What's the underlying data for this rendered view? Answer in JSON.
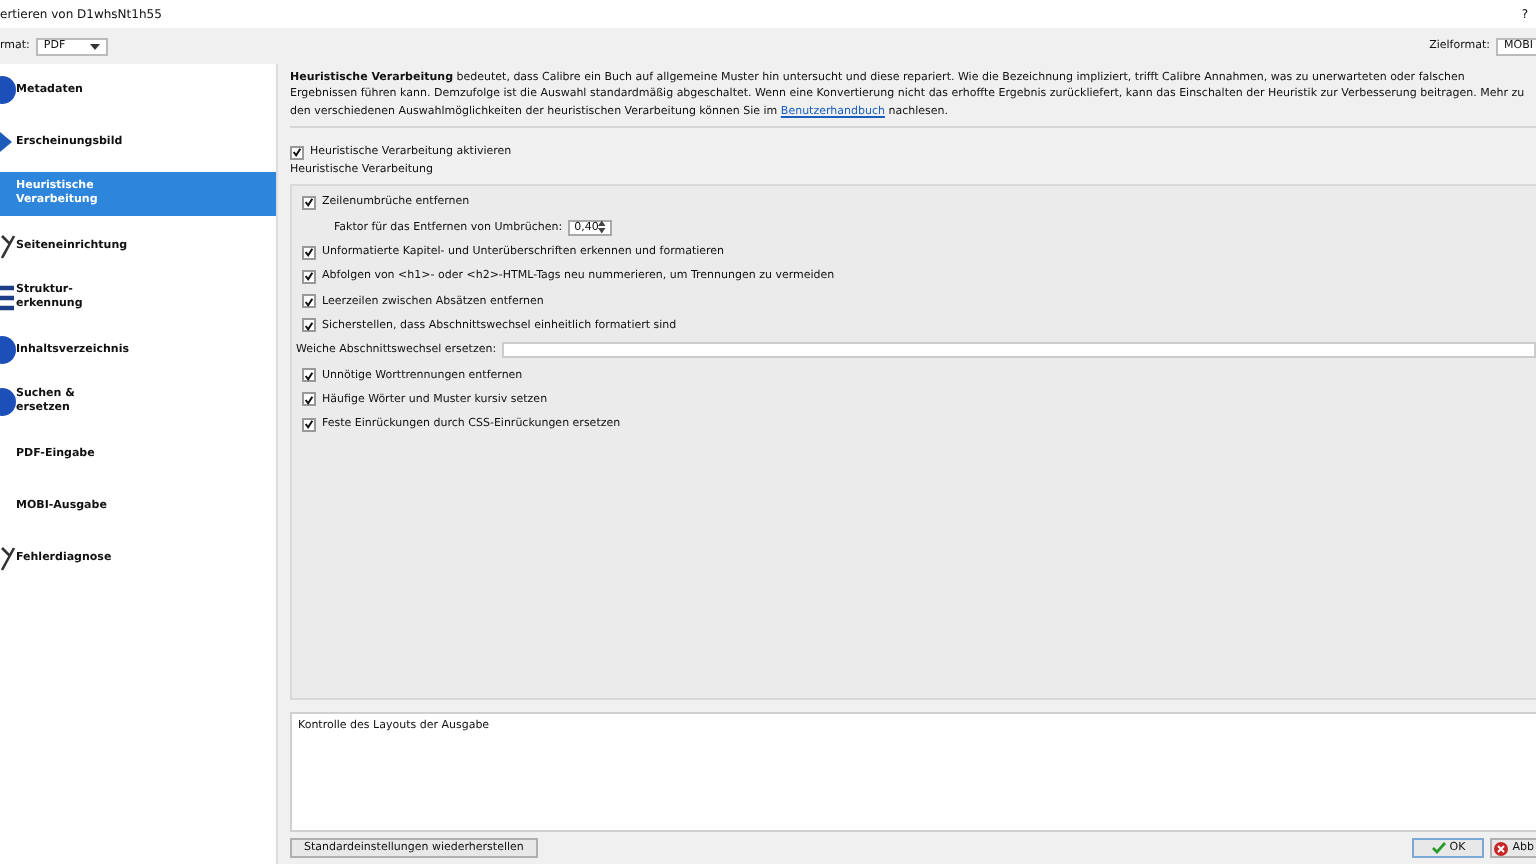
{
  "window": {
    "title": "ertieren von D1whsNt1h55",
    "help": "?"
  },
  "input_format": {
    "label": "rmat:",
    "value": "PDF"
  },
  "output_format": {
    "label": "Zielformat:",
    "value": "MOBI"
  },
  "sidebar": {
    "items": [
      {
        "label": "Metadaten",
        "selected": false
      },
      {
        "label": "Erscheinungsbild",
        "selected": false
      },
      {
        "label": "Heuristische Verarbeitung",
        "selected": true
      },
      {
        "label": "Seiteneinrichtung",
        "selected": false
      },
      {
        "label": "Struktur-erkennung",
        "selected": false
      },
      {
        "label": "Inhaltsverzeichnis",
        "selected": false
      },
      {
        "label": "Suchen & ersetzen",
        "selected": false
      },
      {
        "label": "PDF-Eingabe",
        "selected": false
      },
      {
        "label": "MOBI-Ausgabe",
        "selected": false
      },
      {
        "label": "Fehlerdiagnose",
        "selected": false
      }
    ]
  },
  "description": {
    "text": "**Heuristische Verarbeitung** bedeutet, dass Calibre ein Buch auf allgemeine Muster hin untersucht und diese repariert. Wie die Bezeichnung impliziert, trifft Calibre Annahmen, was zu unerwarteten oder falschen Ergebnissen führen kann. Demzufolge ist die Auswahl standardmäßig abgeschaltet. Wenn eine Konvertierung nicht das erhoffte Ergebnis zurückliefert, kann das Einschalten der Heuristik zur Verbesserung beitragen. Mehr zu den verschiedenen Auswahlmöglichkeiten der heuristischen Verarbeitung können Sie im ",
    "link": "Benutzerhandbuch",
    "end": " nachlesen."
  },
  "enable": {
    "label": "Heuristische Verarbeitung aktivieren",
    "checked": true
  },
  "group": {
    "title": "Heuristische Verarbeitung",
    "options": [
      {
        "kind": "checkbox",
        "label": "Zeilenumbrüche entfernen",
        "checked": true
      },
      {
        "kind": "spinner",
        "label": "Faktor für das Entfernen von Umbrüchen:",
        "value": "0,40"
      },
      {
        "kind": "checkbox",
        "label": "Unformatierte Kapitel- und Unterüberschriften erkennen und formatieren",
        "checked": true
      },
      {
        "kind": "checkbox",
        "label": "Abfolgen von <h1>- oder <h2>-HTML-Tags neu nummerieren, um Trennungen zu vermeiden",
        "checked": true
      },
      {
        "kind": "checkbox",
        "label": "Leerzeilen zwischen Absätzen entfernen",
        "checked": true
      },
      {
        "kind": "checkbox",
        "label": "Sicherstellen, dass Abschnittswechsel einheitlich formatiert sind",
        "checked": true
      },
      {
        "kind": "textfield",
        "label": "Weiche Abschnittswechsel ersetzen:"
      },
      {
        "kind": "checkbox",
        "label": "Unnötige Worttrennungen entfernen",
        "checked": true
      },
      {
        "kind": "checkbox",
        "label": "Häufige Wörter und Muster kursiv setzen",
        "checked": true
      },
      {
        "kind": "checkbox",
        "label": "Feste Einrückungen durch CSS-Einrückungen ersetzen",
        "checked": true
      }
    ]
  },
  "help_text": "Kontrolle des Layouts der Ausgabe",
  "buttons": {
    "restore": "Standardeinstellungen wiederherstellen",
    "ok": "OK",
    "cancel": "Abb"
  }
}
